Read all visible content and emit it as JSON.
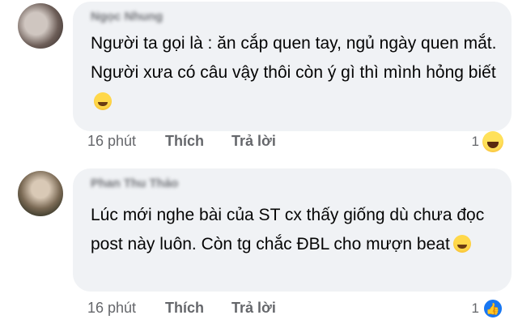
{
  "comments": [
    {
      "author": "Ngọc Nhung",
      "text": "Người ta gọi là : ăn cắp quen tay, ngủ ngày quen mắt. Người xưa có câu vậy thôi còn ý gì thì mình hỏng biết",
      "emoji": "rolling-on-floor-laughing",
      "time": "16 phút",
      "like_label": "Thích",
      "reply_label": "Trả lời",
      "reaction_count": "1",
      "reaction_icon": "laugh-reaction-icon"
    },
    {
      "author": "Phan Thu Thảo",
      "text": "Lúc mới nghe bài của ST cx thấy giống dù chưa đọc post này luôn. Còn tg chắc ĐBL cho mượn beat",
      "emoji": "rolling-on-floor-laughing",
      "time": "16 phút",
      "like_label": "Thích",
      "reply_label": "Trả lời",
      "reaction_count": "1",
      "reaction_icon": "like-reaction-icon"
    }
  ],
  "colors": {
    "bubble": "#f0f2f5",
    "text": "#050505",
    "meta": "#65676b",
    "like_blue": "#1877f2"
  }
}
